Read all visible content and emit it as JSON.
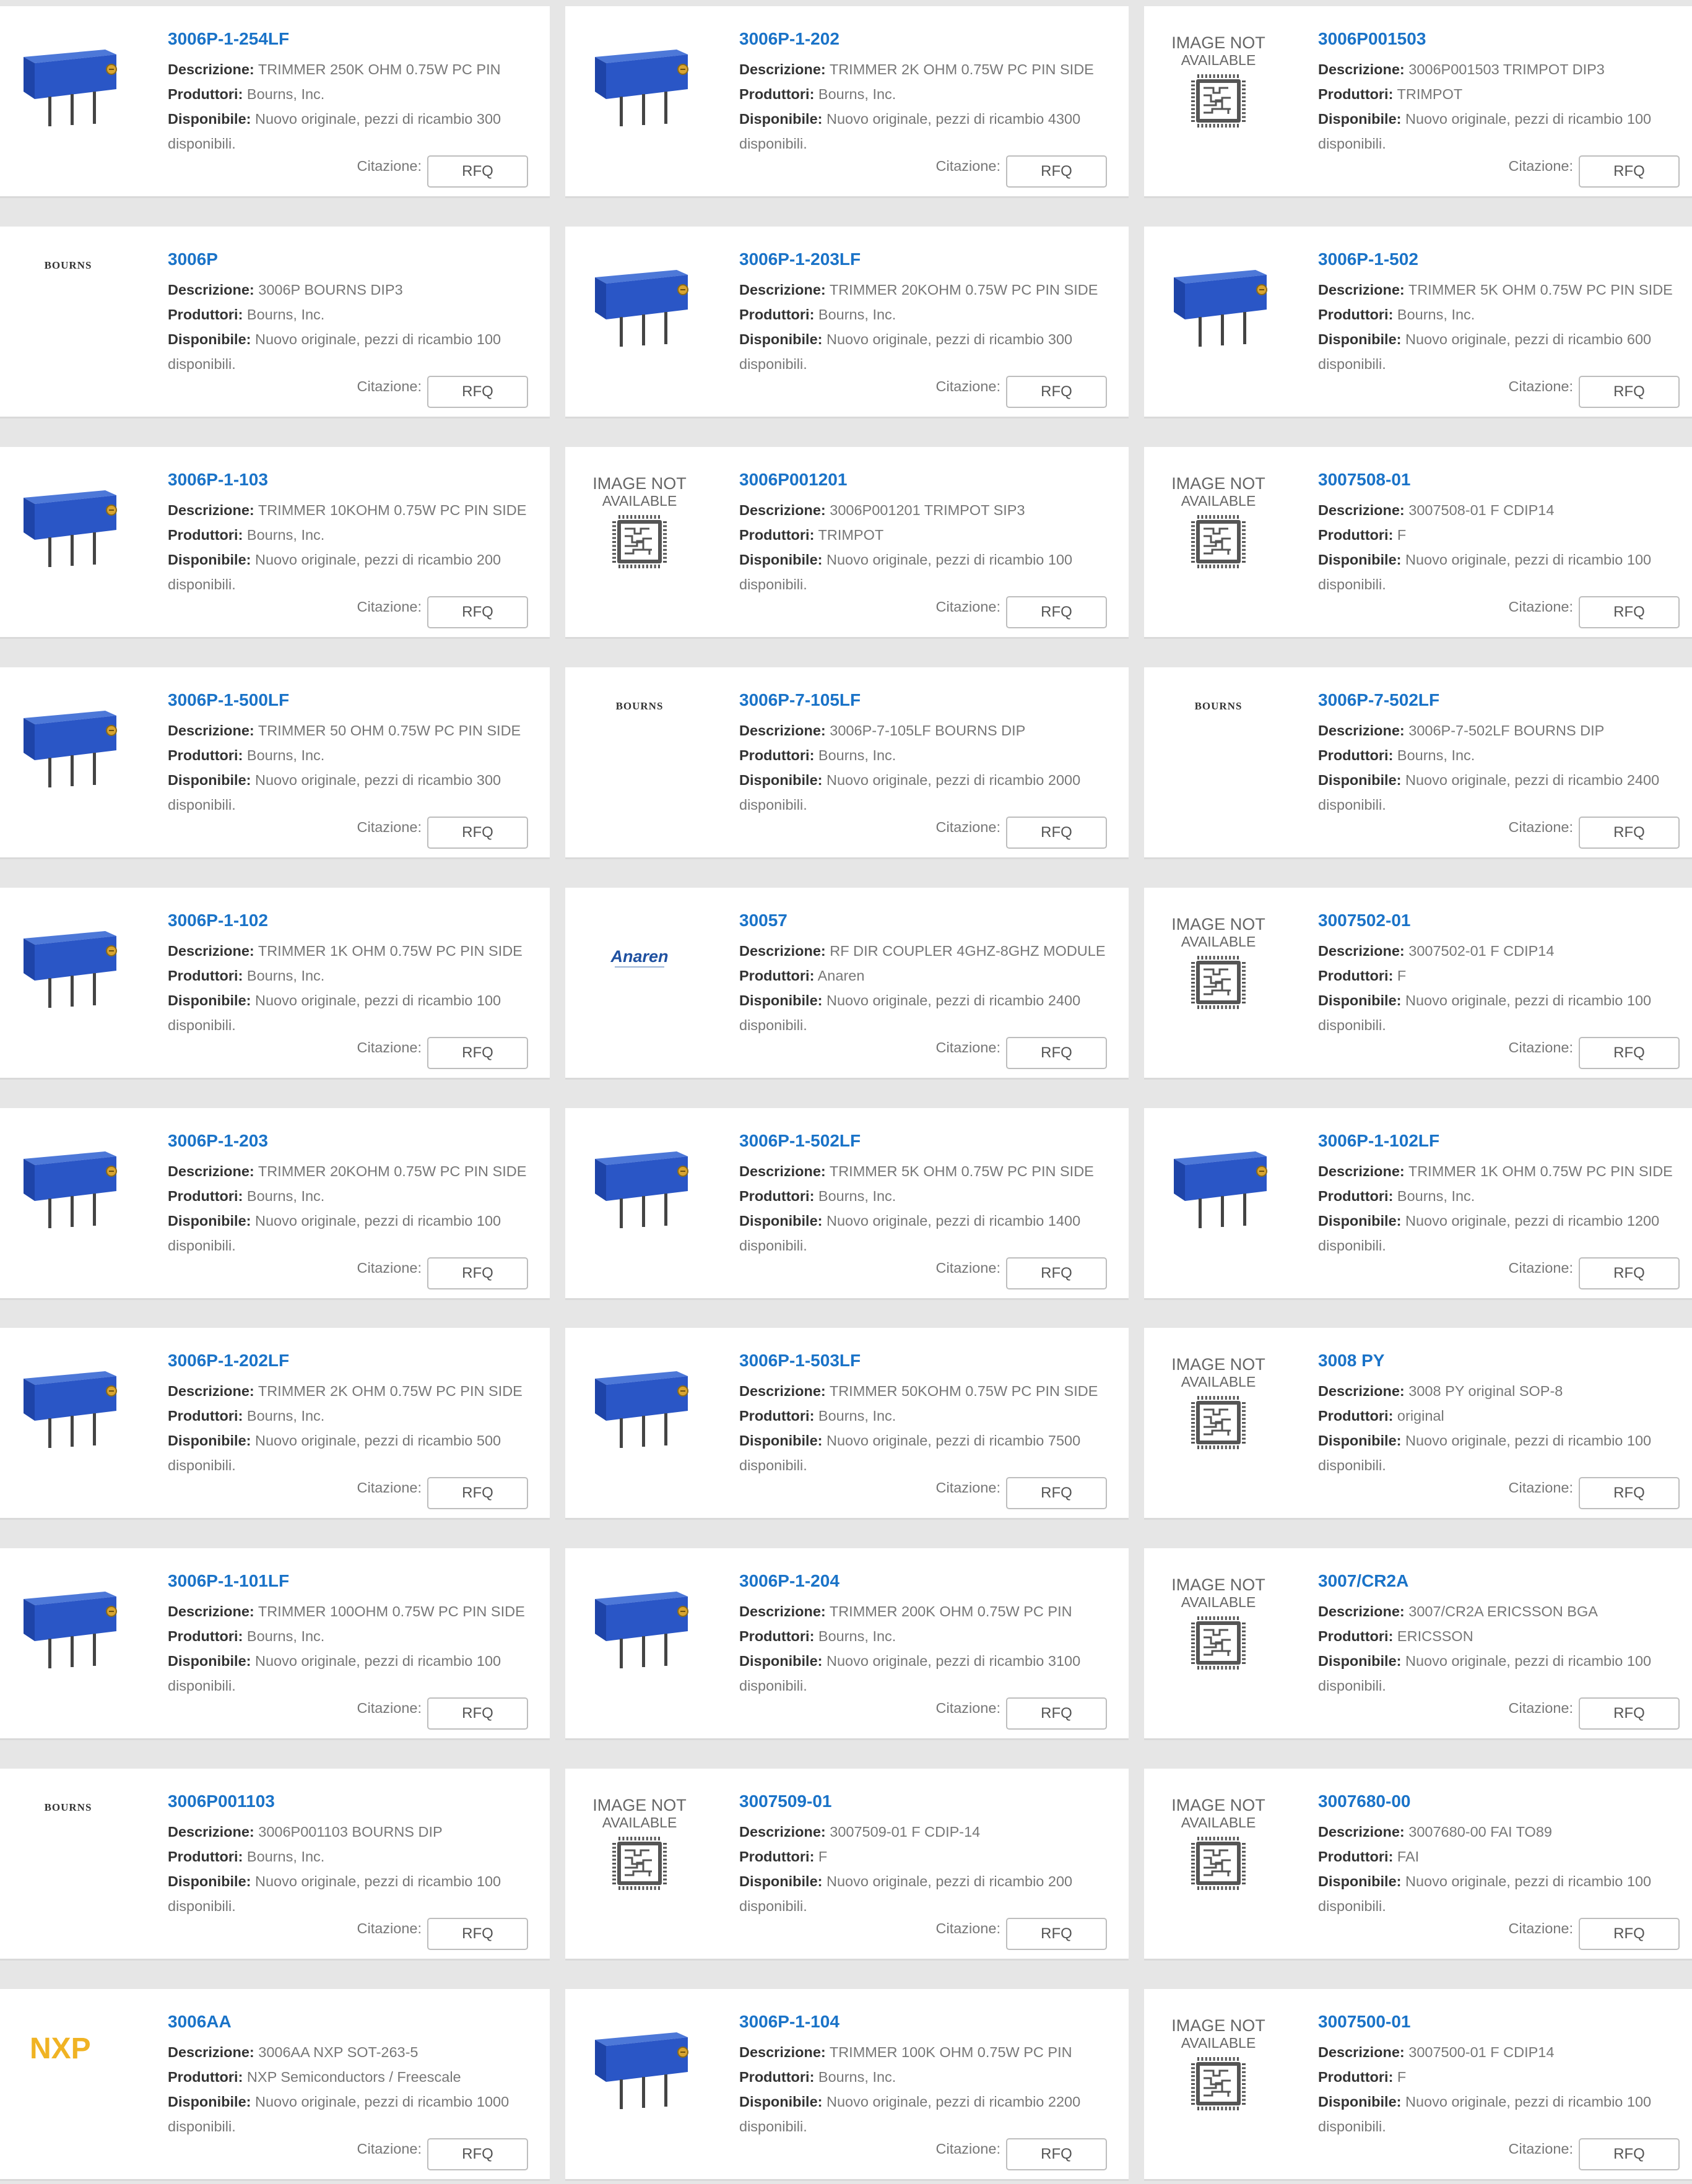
{
  "labels": {
    "descrizione": "Descrizione:",
    "produttori": "Produttori:",
    "disponibile": "Disponibile:",
    "citazione": "Citazione:",
    "rfq": "RFQ",
    "image_not_available_1": "IMAGE NOT",
    "image_not_available_2": "AVAILABLE",
    "bourns_logo": "BOURNS",
    "anaren_logo": "Anaren",
    "nxp_logo": "NXP"
  },
  "colors": {
    "part_number": "#1a73c8",
    "trimmer_blue": "#2a56c6",
    "background": "#e6e6e6"
  },
  "products": [
    {
      "pn": "3006P-1-254LF",
      "img": "trimmer",
      "desc": "TRIMMER 250K OHM 0.75W PC PIN",
      "mfr": "Bourns, Inc.",
      "avail": "Nuovo originale, pezzi di ricambio 300 disponibili."
    },
    {
      "pn": "3006P-1-202",
      "img": "trimmer",
      "desc": "TRIMMER 2K OHM 0.75W PC PIN SIDE",
      "mfr": "Bourns, Inc.",
      "avail": "Nuovo originale, pezzi di ricambio 4300 disponibili."
    },
    {
      "pn": "3006P001503",
      "img": "notavailable",
      "desc": "3006P001503 TRIMPOT DIP3",
      "mfr": "TRIMPOT",
      "avail": "Nuovo originale, pezzi di ricambio 100 disponibili."
    },
    {
      "pn": "3006P",
      "img": "bourns",
      "desc": "3006P BOURNS DIP3",
      "mfr": "Bourns, Inc.",
      "avail": "Nuovo originale, pezzi di ricambio 100 disponibili."
    },
    {
      "pn": "3006P-1-203LF",
      "img": "trimmer",
      "desc": "TRIMMER 20KOHM 0.75W PC PIN SIDE",
      "mfr": "Bourns, Inc.",
      "avail": "Nuovo originale, pezzi di ricambio 300 disponibili."
    },
    {
      "pn": "3006P-1-502",
      "img": "trimmer",
      "desc": "TRIMMER 5K OHM 0.75W PC PIN SIDE",
      "mfr": "Bourns, Inc.",
      "avail": "Nuovo originale, pezzi di ricambio 600 disponibili."
    },
    {
      "pn": "3006P-1-103",
      "img": "trimmer",
      "desc": "TRIMMER 10KOHM 0.75W PC PIN SIDE",
      "mfr": "Bourns, Inc.",
      "avail": "Nuovo originale, pezzi di ricambio 200 disponibili."
    },
    {
      "pn": "3006P001201",
      "img": "notavailable",
      "desc": "3006P001201 TRIMPOT SIP3",
      "mfr": "TRIMPOT",
      "avail": "Nuovo originale, pezzi di ricambio 100 disponibili."
    },
    {
      "pn": "3007508-01",
      "img": "notavailable",
      "desc": "3007508-01 F CDIP14",
      "mfr": "F",
      "avail": "Nuovo originale, pezzi di ricambio 100 disponibili."
    },
    {
      "pn": "3006P-1-500LF",
      "img": "trimmer",
      "desc": "TRIMMER 50 OHM 0.75W PC PIN SIDE",
      "mfr": "Bourns, Inc.",
      "avail": "Nuovo originale, pezzi di ricambio 300 disponibili."
    },
    {
      "pn": "3006P-7-105LF",
      "img": "bourns",
      "desc": "3006P-7-105LF BOURNS DIP",
      "mfr": "Bourns, Inc.",
      "avail": "Nuovo originale, pezzi di ricambio 2000 disponibili."
    },
    {
      "pn": "3006P-7-502LF",
      "img": "bourns",
      "desc": "3006P-7-502LF BOURNS DIP",
      "mfr": "Bourns, Inc.",
      "avail": "Nuovo originale, pezzi di ricambio 2400 disponibili."
    },
    {
      "pn": "3006P-1-102",
      "img": "trimmer",
      "desc": "TRIMMER 1K OHM 0.75W PC PIN SIDE",
      "mfr": "Bourns, Inc.",
      "avail": "Nuovo originale, pezzi di ricambio 100 disponibili."
    },
    {
      "pn": "30057",
      "img": "anaren",
      "desc": "RF DIR COUPLER 4GHZ-8GHZ MODULE",
      "mfr": "Anaren",
      "avail": "Nuovo originale, pezzi di ricambio 2400 disponibili."
    },
    {
      "pn": "3007502-01",
      "img": "notavailable",
      "desc": "3007502-01 F CDIP14",
      "mfr": "F",
      "avail": "Nuovo originale, pezzi di ricambio 100 disponibili."
    },
    {
      "pn": "3006P-1-203",
      "img": "trimmer",
      "desc": "TRIMMER 20KOHM 0.75W PC PIN SIDE",
      "mfr": "Bourns, Inc.",
      "avail": "Nuovo originale, pezzi di ricambio 100 disponibili."
    },
    {
      "pn": "3006P-1-502LF",
      "img": "trimmer",
      "desc": "TRIMMER 5K OHM 0.75W PC PIN SIDE",
      "mfr": "Bourns, Inc.",
      "avail": "Nuovo originale, pezzi di ricambio 1400 disponibili."
    },
    {
      "pn": "3006P-1-102LF",
      "img": "trimmer",
      "desc": "TRIMMER 1K OHM 0.75W PC PIN SIDE",
      "mfr": "Bourns, Inc.",
      "avail": "Nuovo originale, pezzi di ricambio 1200 disponibili."
    },
    {
      "pn": "3006P-1-202LF",
      "img": "trimmer",
      "desc": "TRIMMER 2K OHM 0.75W PC PIN SIDE",
      "mfr": "Bourns, Inc.",
      "avail": "Nuovo originale, pezzi di ricambio 500 disponibili."
    },
    {
      "pn": "3006P-1-503LF",
      "img": "trimmer",
      "desc": "TRIMMER 50KOHM 0.75W PC PIN SIDE",
      "mfr": "Bourns, Inc.",
      "avail": "Nuovo originale, pezzi di ricambio 7500 disponibili."
    },
    {
      "pn": "3008 PY",
      "img": "notavailable",
      "desc": "3008 PY original SOP-8",
      "mfr": "original",
      "avail": "Nuovo originale, pezzi di ricambio 100 disponibili."
    },
    {
      "pn": "3006P-1-101LF",
      "img": "trimmer",
      "desc": "TRIMMER 100OHM 0.75W PC PIN SIDE",
      "mfr": "Bourns, Inc.",
      "avail": "Nuovo originale, pezzi di ricambio 100 disponibili."
    },
    {
      "pn": "3006P-1-204",
      "img": "trimmer",
      "desc": "TRIMMER 200K OHM 0.75W PC PIN",
      "mfr": "Bourns, Inc.",
      "avail": "Nuovo originale, pezzi di ricambio 3100 disponibili."
    },
    {
      "pn": "3007/CR2A",
      "img": "notavailable",
      "desc": "3007/CR2A ERICSSON BGA",
      "mfr": "ERICSSON",
      "avail": "Nuovo originale, pezzi di ricambio 100 disponibili."
    },
    {
      "pn": "3006P001103",
      "img": "bourns",
      "desc": "3006P001103 BOURNS DIP",
      "mfr": "Bourns, Inc.",
      "avail": "Nuovo originale, pezzi di ricambio 100 disponibili."
    },
    {
      "pn": "3007509-01",
      "img": "notavailable",
      "desc": "3007509-01 F CDIP-14",
      "mfr": "F",
      "avail": "Nuovo originale, pezzi di ricambio 200 disponibili."
    },
    {
      "pn": "3007680-00",
      "img": "notavailable",
      "desc": "3007680-00 FAI TO89",
      "mfr": "FAI",
      "avail": "Nuovo originale, pezzi di ricambio 100 disponibili."
    },
    {
      "pn": "3006AA",
      "img": "nxp",
      "desc": "3006AA NXP SOT-263-5",
      "mfr": "NXP Semiconductors / Freescale",
      "avail": "Nuovo originale, pezzi di ricambio 1000 disponibili."
    },
    {
      "pn": "3006P-1-104",
      "img": "trimmer",
      "desc": "TRIMMER 100K OHM 0.75W PC PIN",
      "mfr": "Bourns, Inc.",
      "avail": "Nuovo originale, pezzi di ricambio 2200 disponibili."
    },
    {
      "pn": "3007500-01",
      "img": "notavailable",
      "desc": "3007500-01 F CDIP14",
      "mfr": "F",
      "avail": "Nuovo originale, pezzi di ricambio 100 disponibili."
    }
  ]
}
